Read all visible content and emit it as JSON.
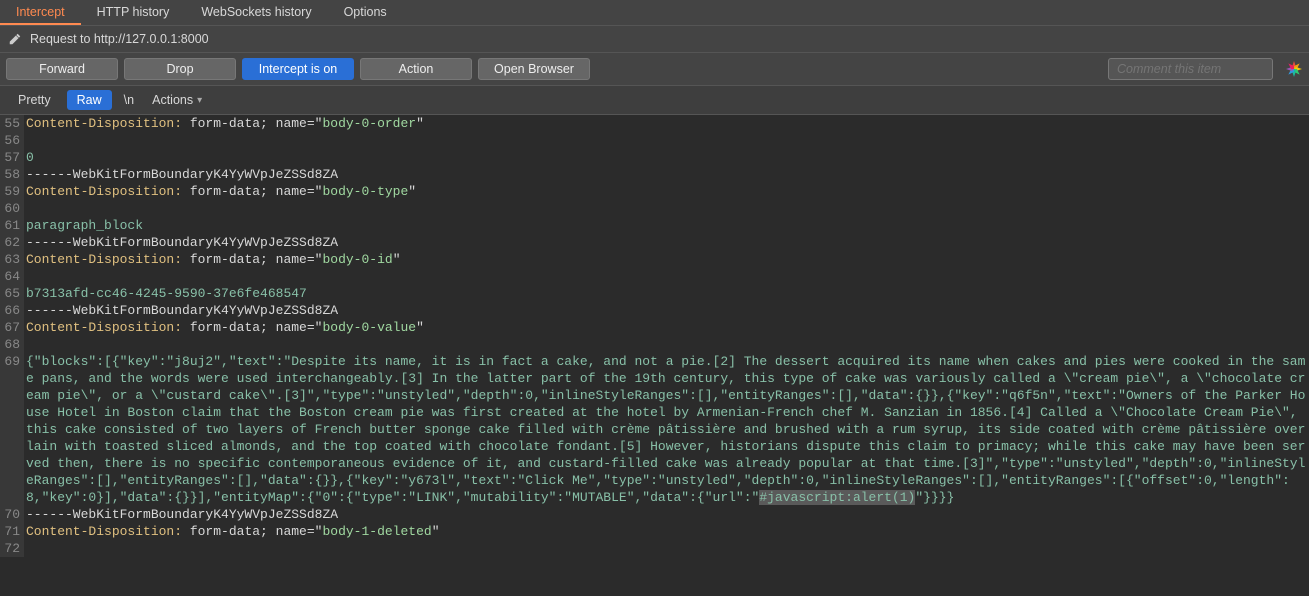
{
  "tabs": {
    "intercept": "Intercept",
    "http_history": "HTTP history",
    "websockets_history": "WebSockets history",
    "options": "Options"
  },
  "request_bar": {
    "text": "Request to http://127.0.0.1:8000"
  },
  "buttons": {
    "forward": "Forward",
    "drop": "Drop",
    "intercept": "Intercept is on",
    "action": "Action",
    "open_browser": "Open Browser"
  },
  "comment_placeholder": "Comment this item",
  "view": {
    "pretty": "Pretty",
    "raw": "Raw",
    "ln": "\\n",
    "actions": "Actions"
  },
  "lines": {
    "l55": {
      "n": "55",
      "h": "Content-Disposition:",
      "m": " form-data; name=\"",
      "v": "body-0-order",
      "e": "\""
    },
    "l56": {
      "n": "56"
    },
    "l57": {
      "n": "57",
      "t": "0"
    },
    "l58": {
      "n": "58",
      "t": "------WebKitFormBoundaryK4YyWVpJeZSSd8ZA"
    },
    "l59": {
      "n": "59",
      "h": "Content-Disposition:",
      "m": " form-data; name=\"",
      "v": "body-0-type",
      "e": "\""
    },
    "l60": {
      "n": "60"
    },
    "l61": {
      "n": "61",
      "t": "paragraph_block"
    },
    "l62": {
      "n": "62",
      "t": "------WebKitFormBoundaryK4YyWVpJeZSSd8ZA"
    },
    "l63": {
      "n": "63",
      "h": "Content-Disposition:",
      "m": " form-data; name=\"",
      "v": "body-0-id",
      "e": "\""
    },
    "l64": {
      "n": "64"
    },
    "l65": {
      "n": "65",
      "t": "b7313afd-cc46-4245-9590-37e6fe468547"
    },
    "l66": {
      "n": "66",
      "t": "------WebKitFormBoundaryK4YyWVpJeZSSd8ZA"
    },
    "l67": {
      "n": "67",
      "h": "Content-Disposition:",
      "m": " form-data; name=\"",
      "v": "body-0-value",
      "e": "\""
    },
    "l68": {
      "n": "68"
    },
    "l69a": "{\"blocks\":[{\"key\":\"j8uj2\",\"text\":\"Despite its name, it is in fact a cake, and not a pie.[2] The dessert acquired its name when cakes and pies were cooked in the same pans, and the words were used interchangeably.[3] In the latter part of the 19th century, this type of cake was variously called a \\\"cream pie\\\", a \\\"chocolate cream pie\\\", or a \\\"custard cake\\\".[3]\",\"type\":\"unstyled\",\"depth\":0,\"inlineStyleRanges\":[],\"entityRanges\":[],\"data\":{}},{\"key\":\"q6f5n\",\"text\":\"Owners of the Parker House Hotel in Boston claim that the Boston cream pie was first created at the hotel by Armenian-French chef M. Sanzian in 1856.[4] Called a \\\"Chocolate Cream Pie\\\", this cake consisted of two layers of French butter sponge cake filled with crème pâtissière and brushed with a rum syrup, its side coated with crème pâtissière overlain with toasted sliced almonds, and the top coated with chocolate fondant.[5] However, historians dispute this claim to primacy; while this cake may have been served then, there is no specific contemporaneous evidence of it, and custard-filled cake was already popular at that time.[3]\",\"type\":\"unstyled\",\"depth\":0,\"inlineStyleRanges\":[],\"entityRanges\":[],\"data\":{}},{\"key\":\"y673l\",\"text\":\"Click Me\",\"type\":\"unstyled\",\"depth\":0,\"inlineStyleRanges\":[],\"entityRanges\":[{\"offset\":0,\"length\":8,\"key\":0}],\"data\":{}}],\"entityMap\":{\"0\":{\"type\":\"LINK\",\"mutability\":\"MUTABLE\",\"data\":{\"url\":\"",
    "l69hl": "#javascript:alert(1)",
    "l69b": "\"}}}}",
    "l69n": "69",
    "l70": {
      "n": "70",
      "t": "------WebKitFormBoundaryK4YyWVpJeZSSd8ZA"
    },
    "l71": {
      "n": "71",
      "h": "Content-Disposition:",
      "m": " form-data; name=\"",
      "v": "body-1-deleted",
      "e": "\""
    },
    "l72": {
      "n": "72"
    }
  }
}
